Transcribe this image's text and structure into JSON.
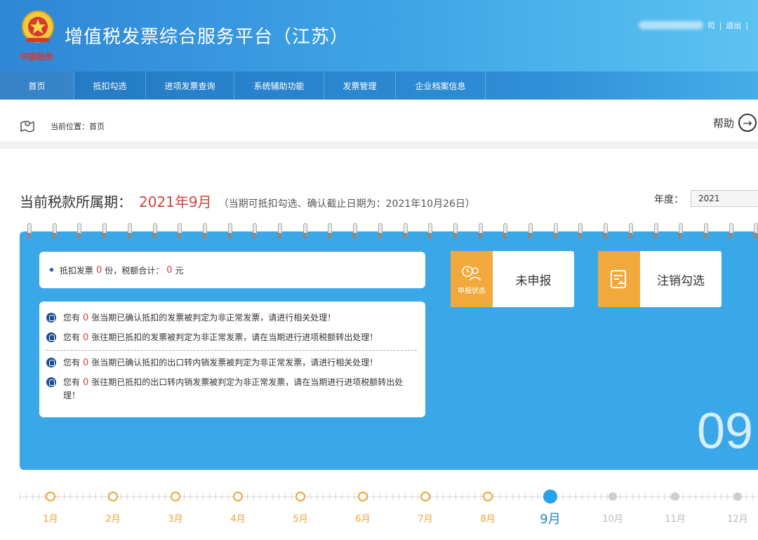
{
  "header": {
    "title": "增值税发票综合服务平台（江苏）",
    "emblem_text": "中国税务",
    "user_suffix": "司",
    "logout": "退出",
    "separator": "|"
  },
  "nav": {
    "items": [
      {
        "label": "首页",
        "active": true
      },
      {
        "label": "抵扣勾选"
      },
      {
        "label": "进项发票查询"
      },
      {
        "label": "系统辅助功能"
      },
      {
        "label": "发票管理"
      },
      {
        "label": "企业档案信息"
      }
    ]
  },
  "breadcrumb": {
    "text": "当前位置：首页",
    "help": "帮助"
  },
  "period": {
    "label": "当前税款所属期：",
    "value": "2021年9月",
    "note": "（当期可抵扣勾选、确认截止日期为：2021年10月26日）",
    "year_label": "年度：",
    "year_value": "2021"
  },
  "summary": {
    "prefix": "抵扣发票",
    "count": "0",
    "mid": "份，税额合计：",
    "amount": "0",
    "suffix": "元"
  },
  "alerts": [
    {
      "pre": "您有",
      "count": "0",
      "post": "张当期已确认抵扣的发票被判定为非正常发票，请进行相关处理！"
    },
    {
      "pre": "您有",
      "count": "0",
      "post": "张往期已抵扣的发票被判定为非正常发票，请在当期进行进项税额转出处理！"
    },
    {
      "pre": "您有",
      "count": "0",
      "post": "张当期已确认抵扣的出口转内销发票被判定为非正常发票，请进行相关处理！"
    },
    {
      "pre": "您有",
      "count": "0",
      "post": "张往期已抵扣的出口转内销发票被判定为非正常发票，请在当期进行进项税额转出处理！"
    }
  ],
  "tiles": {
    "status": {
      "icon_label": "申报状态",
      "text": "未申报"
    },
    "cancel": {
      "text": "注销勾选"
    }
  },
  "big_month": "09",
  "timeline": {
    "months": [
      "1月",
      "2月",
      "3月",
      "4月",
      "5月",
      "6月",
      "7月",
      "8月",
      "9月",
      "10月",
      "11月",
      "12月"
    ],
    "current_index": 8
  },
  "colors": {
    "accent": "#3aa7e8",
    "orange": "#f0a23a",
    "red": "#d0443a"
  }
}
